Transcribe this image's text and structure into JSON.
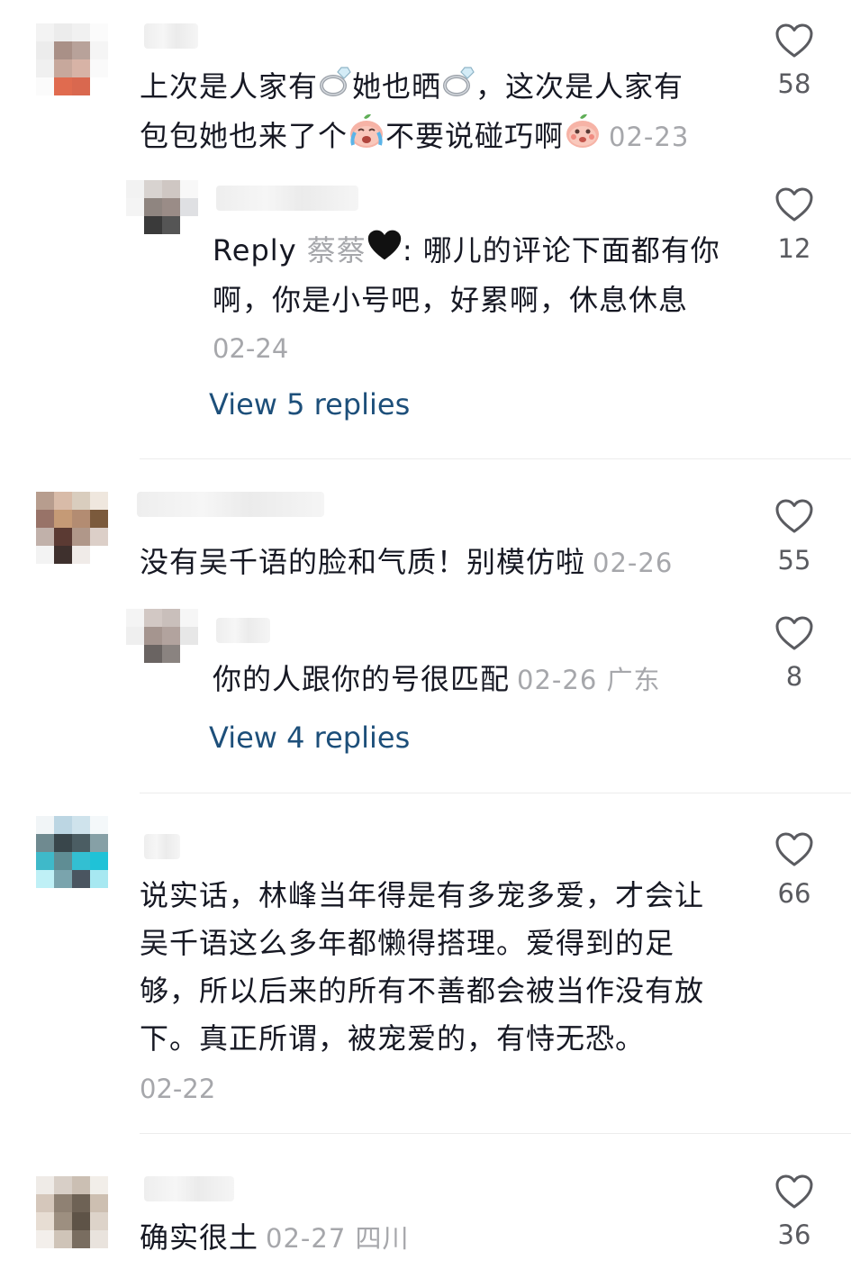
{
  "comments": [
    {
      "text_line1_a": "上次是人家有",
      "icon_ring_1": "ring-emoji",
      "text_line1_b": "她也晒",
      "icon_ring_2": "ring-emoji",
      "text_line1_c": "，这次是人家有",
      "text_line2_a": "包包她也来了个",
      "icon_crying": "crying-peach-emoji",
      "text_line2_b": "不要说碰巧啊",
      "icon_shy": "shy-peach-emoji",
      "date": "02-23",
      "likes": "58",
      "reply": {
        "prefix": "Reply",
        "name": "蔡蔡",
        "name_icon": "black-heart-emoji",
        "text_a": ": 哪儿的评论下面都有你",
        "text_b": "啊，你是小号吧，好累啊，休息休息",
        "date": "02-24",
        "likes": "12"
      },
      "view_replies": "View 5 replies"
    },
    {
      "text": "没有吴千语的脸和气质！别模仿啦",
      "date": "02-26",
      "likes": "55",
      "reply": {
        "text": "你的人跟你的号很匹配",
        "date": "02-26 广东",
        "likes": "8"
      },
      "view_replies": "View 4 replies"
    },
    {
      "line1": "说实话，林峰当年得是有多宠多爱，才会让",
      "line2": "吴千语这么多年都懒得搭理。爱得到的足",
      "line3": "够，所以后来的所有不善都会被当作没有放",
      "line4": "下。真正所谓，被宠爱的，有恃无恐。",
      "date": "02-22",
      "likes": "66"
    },
    {
      "text": "确实很土",
      "date": "02-27 四川",
      "likes": "36"
    }
  ],
  "colors": {
    "text": "#161823",
    "meta": "#a6a7ab",
    "link": "#1d4f7a",
    "divider": "#ececec"
  }
}
